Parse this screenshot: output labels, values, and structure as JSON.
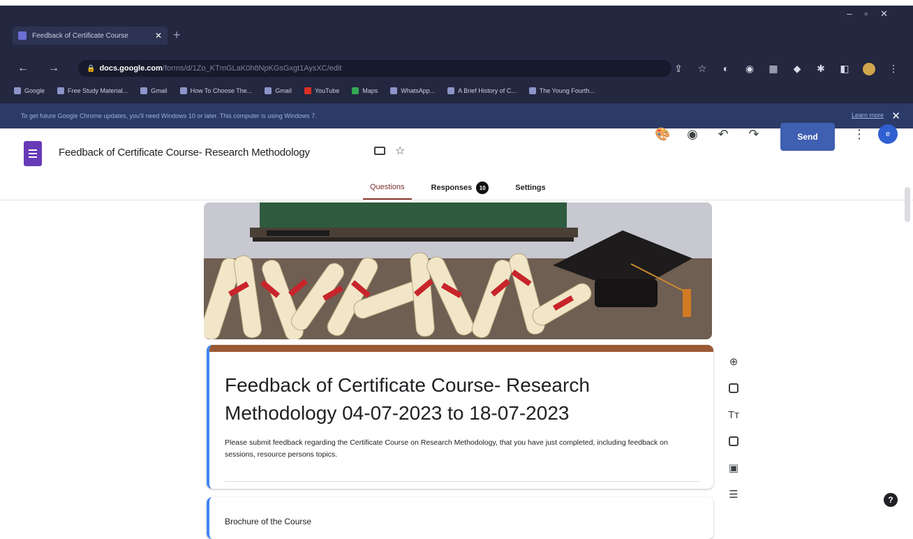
{
  "browser": {
    "tab_title": "Feedback of Certificate Course",
    "new_tab_glyph": "+",
    "url_host": "docs.google.com",
    "url_path": "/forms/d/1Zo_KTmGLaK0h8NpKGsGxgt1AysXC/edit",
    "bookmarks": [
      "Google",
      "Free Study Material...",
      "Gmail",
      "How To Choose The...",
      "Gmail",
      "YouTube",
      "Maps",
      "WhatsApp...",
      "A Brief History of C...",
      "The Young Fourth..."
    ],
    "infobar_text": "To get future Google Chrome updates, you'll need Windows 10 or later. This computer is using Windows 7.",
    "infobar_link": "Learn more"
  },
  "forms": {
    "doc_title": "Feedback of Certificate Course- Research Methodology",
    "send_label": "Send",
    "avatar_letter": "e",
    "tabs": {
      "questions": "Questions",
      "responses": "Responses",
      "responses_count": "10",
      "settings": "Settings"
    },
    "form_title": "Feedback of Certificate Course- Research Methodology 04-07-2023 to 18-07-2023",
    "form_description": "Please submit feedback regarding the Certificate Course on Research Methodology, that you have just completed, including feedback on sessions, resource persons topics.",
    "next_section_title": "Brochure of the Course",
    "toolbar_text_glyph": "Tт",
    "help_glyph": "?"
  },
  "colors": {
    "chrome_bg": "#23273f",
    "infobar_bg": "#2b3a66",
    "send_button": "#3f5fb0",
    "tab_underline": "#8b3a2e",
    "header_band": "#9a5a35",
    "card_accent": "#4285f4"
  },
  "icons": {
    "header": [
      "palette-icon",
      "preview-eye-icon",
      "undo-icon",
      "redo-icon",
      "more-vert-icon"
    ],
    "toolbar": [
      "add-question-icon",
      "import-questions-icon",
      "add-title-icon",
      "add-image-icon",
      "add-video-icon",
      "add-section-icon"
    ]
  }
}
